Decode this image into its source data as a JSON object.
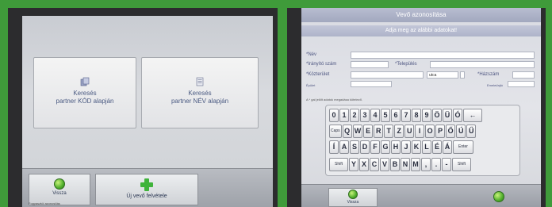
{
  "left": {
    "cards": [
      {
        "label": "Keresés",
        "label2": "partner KÓD alapján",
        "icon": "card-stack-icon"
      },
      {
        "label": "Keresés",
        "label2": "partner NÉV alapján",
        "icon": "list-icon"
      }
    ],
    "buttons": {
      "back": "Vissza",
      "new_customer": "Új vevő felvétele"
    },
    "footer": "Fogyasztói azonosítás"
  },
  "right": {
    "title": "Vevő azonosítása",
    "subtitle": "Adja meg az alábbi adatokat!",
    "fields": {
      "name": "*Név",
      "zip": "*Irányító szám",
      "city": "*Település",
      "street": "*Közterület",
      "street_type": "utca",
      "house_number": "*Házszám",
      "small_left": "Épület",
      "small_right": "Emelet/ajtó"
    },
    "note": "A * gal jelölt adatok megadása kötelező.",
    "keyboard": {
      "row1": [
        "0",
        "1",
        "2",
        "3",
        "4",
        "5",
        "6",
        "7",
        "8",
        "9",
        "Ö",
        "Ü",
        "Ó",
        "←"
      ],
      "row2": [
        "Caps",
        "Q",
        "W",
        "E",
        "R",
        "T",
        "Z",
        "U",
        "I",
        "O",
        "P",
        "Ő",
        "Ú",
        "Ű"
      ],
      "row3": [
        "Í",
        "A",
        "S",
        "D",
        "F",
        "G",
        "H",
        "J",
        "K",
        "L",
        "É",
        "Á",
        "Enter"
      ],
      "row4": [
        "Shift",
        "Y",
        "X",
        "C",
        "V",
        "B",
        "N",
        "M",
        ",",
        ".",
        "-",
        "Shift"
      ]
    },
    "buttons": {
      "back": "Vissza"
    }
  }
}
